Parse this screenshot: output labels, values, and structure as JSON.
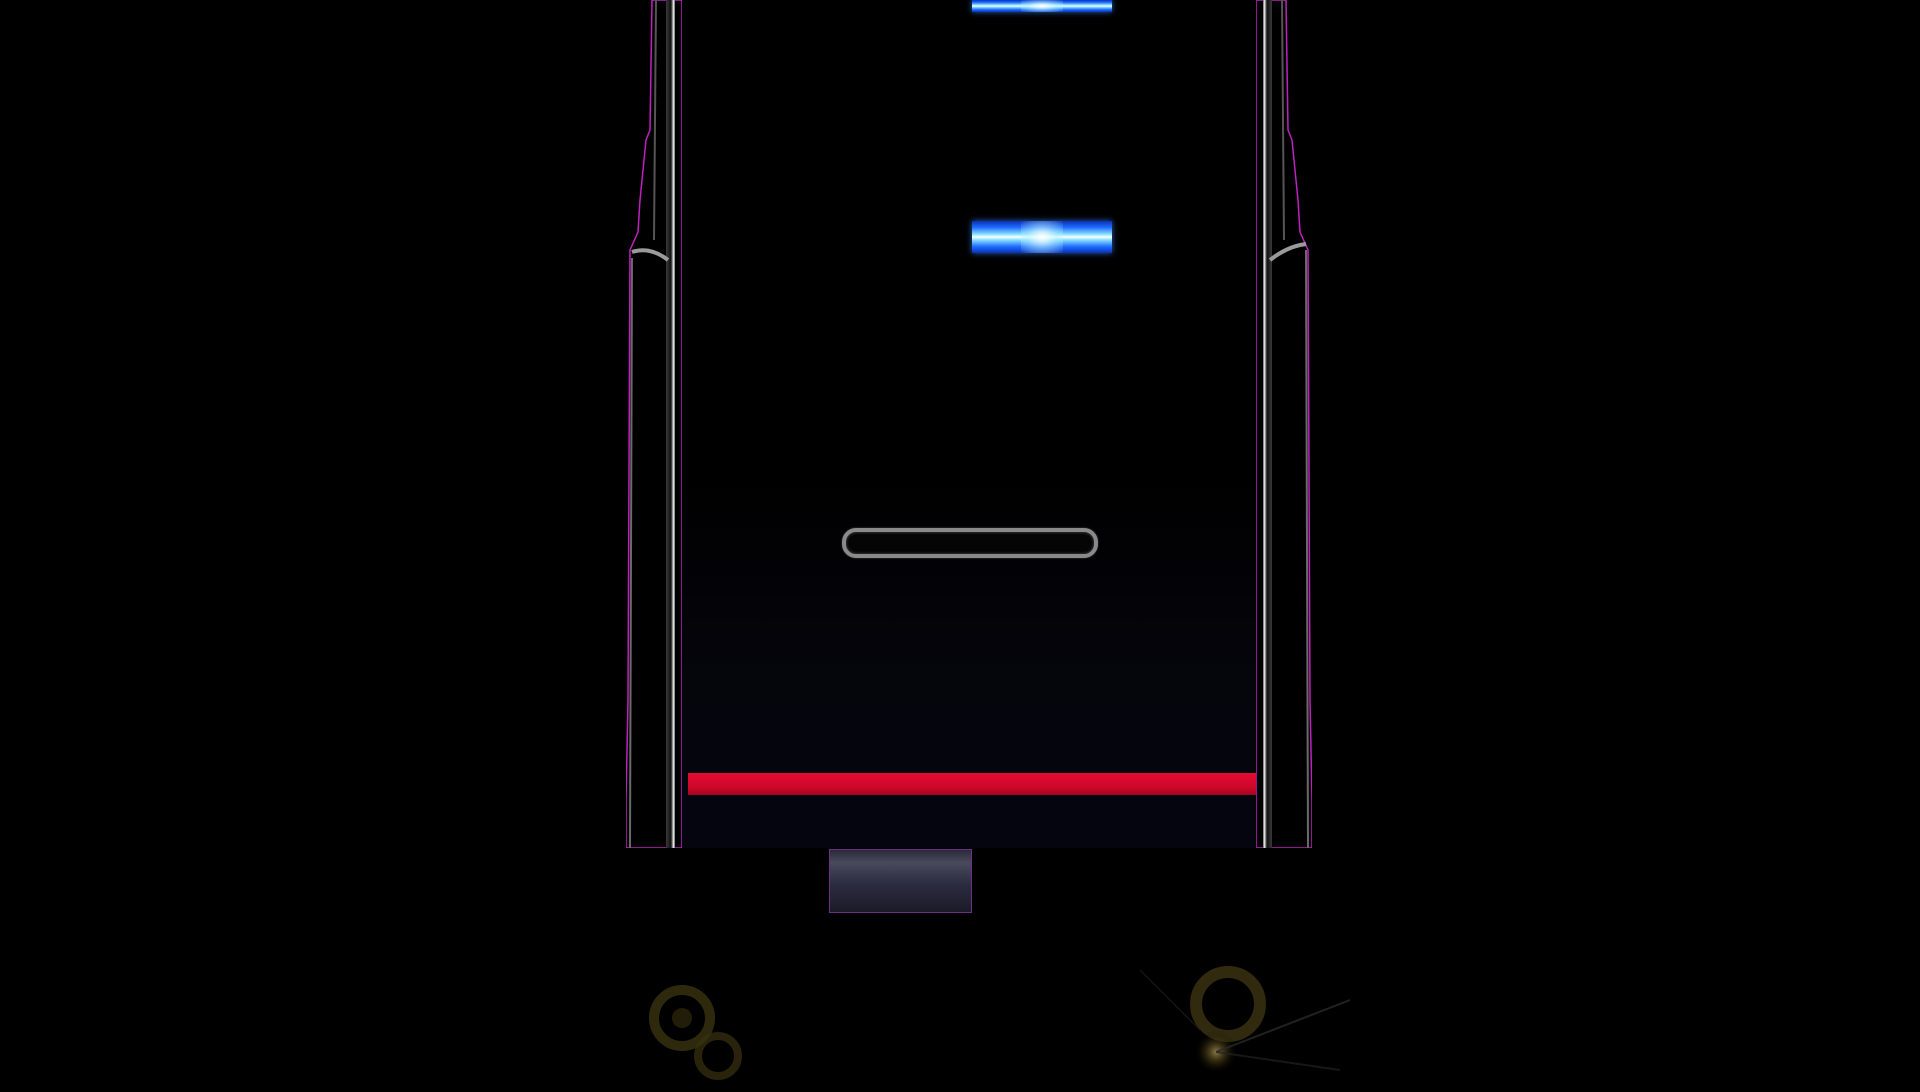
{
  "scene": "rhythm-game-lane",
  "colors": {
    "background": "#000000",
    "rail_outline": "#c020c0",
    "rail_highlight": "#ffffff",
    "note_blue": "#1e6cff",
    "hold_outline": "#8a8a8a",
    "judgement_line": "#d0082b",
    "key_pad": "#3a3a4e",
    "key_pad_border": "#6c2f86",
    "effect_glow": "#6b5a1a"
  },
  "icons": {
    "left_effect": "sparkle-icon",
    "right_effect": "sparkle-icon"
  }
}
